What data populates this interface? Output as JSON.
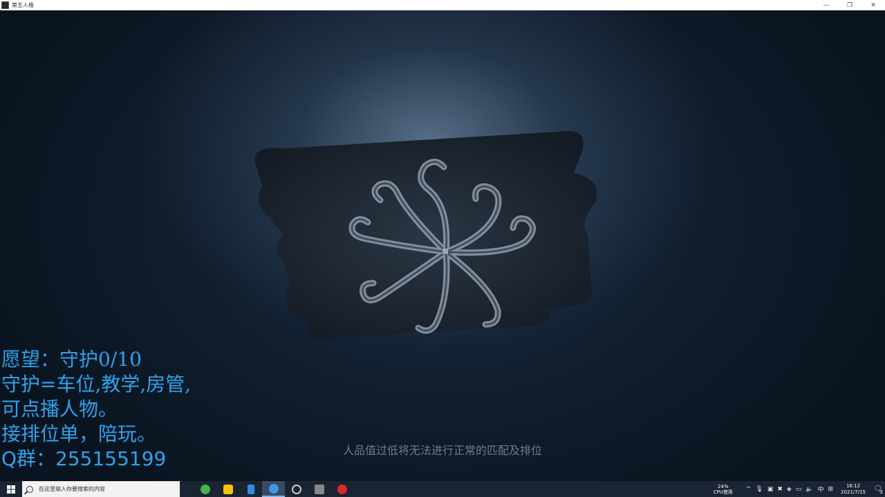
{
  "window": {
    "title": "第五人格",
    "controls": [
      "—",
      "❐",
      "✕"
    ]
  },
  "game": {
    "notice": "人品值过低将无法进行正常的匹配及排位"
  },
  "overlay": {
    "lines": [
      "愿望：守护0/10",
      "守护=车位,教学,房管,",
      "可点播人物。",
      "接排位单，陪玩。",
      "Q群：255155199"
    ]
  },
  "taskbar": {
    "search_placeholder": "在这里输入你要搜索的内容",
    "apps": [
      {
        "icon": "green-app-icon",
        "color": "#3fb84a"
      },
      {
        "icon": "yellow-app-icon",
        "color": "#f3c400"
      },
      {
        "icon": "phone-app-icon",
        "color": "#2f8de4"
      },
      {
        "icon": "browser-app-icon",
        "color": "#3c98e8"
      },
      {
        "icon": "clock-app-icon",
        "color": "#cccccc"
      },
      {
        "icon": "game-app-icon",
        "color": "#888888"
      },
      {
        "icon": "netease-music-icon",
        "color": "#e0262c"
      }
    ],
    "cpu_percent": "24%",
    "cpu_label": "CPU使用",
    "ime": "中",
    "time": "16:12",
    "date": "2021/7/15",
    "notification_count": "3"
  }
}
